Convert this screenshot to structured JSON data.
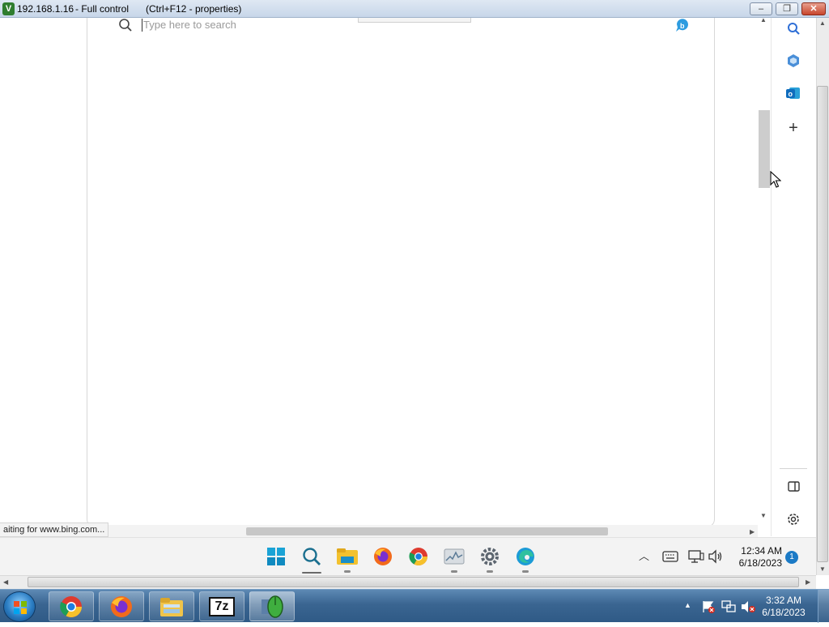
{
  "titlebar": {
    "host": "192.168.1.16",
    "mode": "- Full control",
    "hint": "(Ctrl+F12 - properties)",
    "minimize": "‒",
    "restore": "❐",
    "close": "✕"
  },
  "browser": {
    "search_placeholder": "Type here to search",
    "status": "aiting for www.bing.com...",
    "sidebar": {
      "search": "search-icon",
      "copilot": "copilot-icon",
      "outlook": "outlook-icon",
      "add": "+",
      "split": "split-screen-icon",
      "settings": "gear-icon"
    }
  },
  "w11_taskbar": {
    "icons": [
      "windows-start-icon",
      "search-icon",
      "file-explorer-icon",
      "firefox-icon",
      "chrome-icon",
      "task-manager-icon",
      "settings-icon",
      "edge-icon"
    ],
    "time": "12:34 AM",
    "date": "6/18/2023",
    "notification_count": "1"
  },
  "w7_taskbar": {
    "pinned": [
      "chrome-icon",
      "firefox-icon",
      "explorer-icon",
      "7zip-icon",
      "radmin-viewer-icon"
    ],
    "sevenzip_label": "7z",
    "time": "3:32 AM",
    "date": "6/18/2023",
    "tray_arrow": "▲"
  },
  "colors": {
    "w7_taskbar": "#3a6591",
    "w11_taskbar": "#f3f3f3",
    "accent_blue": "#1b7ac6"
  }
}
